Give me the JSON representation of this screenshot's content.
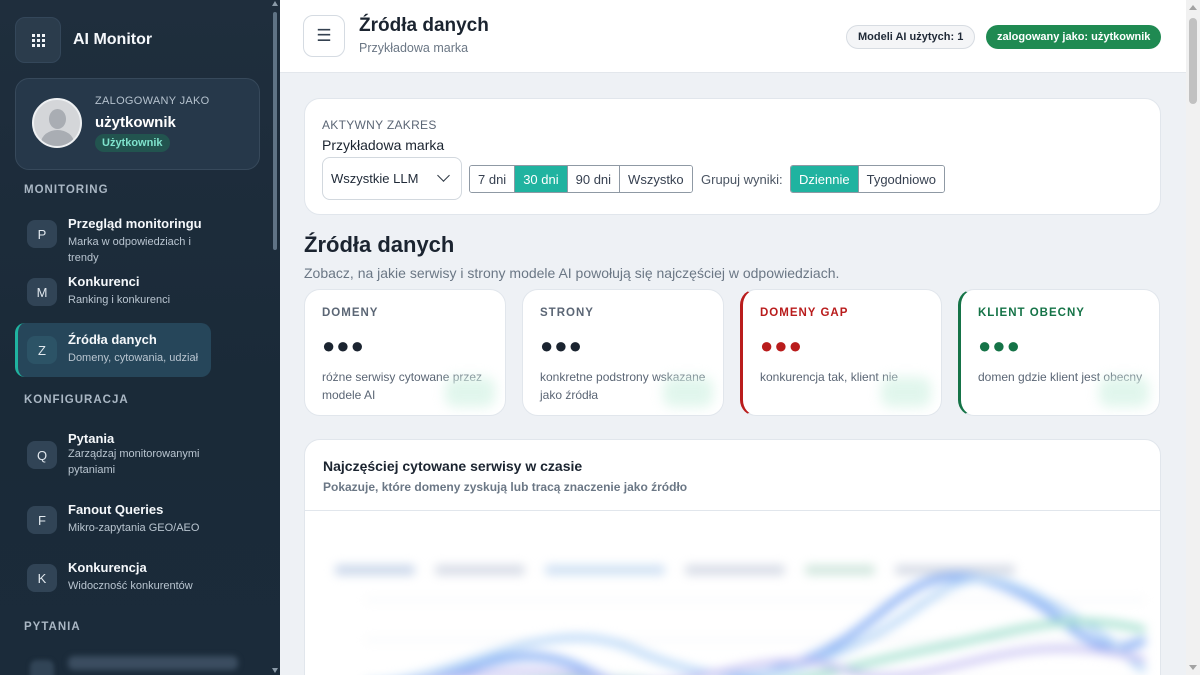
{
  "sidebar": {
    "app_name": "AI Monitor",
    "user": {
      "label": "ZALOGOWANY JAKO",
      "name": "użytkownik",
      "role": "Użytkownik"
    },
    "sections": {
      "monitoring": "MONITORING",
      "konfiguracja": "KONFIGURACJA",
      "pytania": "PYTANIA"
    },
    "items": [
      {
        "letter": "P",
        "title": "Przegląd monitoringu",
        "sub": "Marka w odpowiedziach i trendy"
      },
      {
        "letter": "M",
        "title": "Konkurenci",
        "sub": "Ranking i konkurenci"
      },
      {
        "letter": "Z",
        "title": "Źródła danych",
        "sub": "Domeny, cytowania, udział",
        "active": true
      },
      {
        "letter": "Q",
        "title": "Pytania",
        "sub": "Zarządzaj monitorowanymi pytaniami"
      },
      {
        "letter": "F",
        "title": "Fanout Queries",
        "sub": "Mikro-zapytania GEO/AEO"
      },
      {
        "letter": "K",
        "title": "Konkurencja",
        "sub": "Widoczność konkurentów"
      }
    ]
  },
  "header": {
    "menu_icon": "☰",
    "title": "Źródła danych",
    "subtitle": "Przykładowa marka",
    "models_pill": "Modeli AI użytych: 1",
    "logged_pill": "zalogowany jako: użytkownik"
  },
  "filter": {
    "label": "AKTYWNY ZAKRES",
    "brand": "Przykładowa marka",
    "llm_select": "Wszystkie LLM",
    "ranges": [
      "7 dni",
      "30 dni",
      "90 dni",
      "Wszystko"
    ],
    "active_range": "30 dni",
    "group_label": "Grupuj wyniki:",
    "groups": [
      "Dziennie",
      "Tygodniowo"
    ],
    "active_group": "Dziennie"
  },
  "section": {
    "title": "Źródła danych",
    "subtitle": "Zobacz, na jakie serwisy i strony modele AI powołują się najczęściej w odpowiedziach."
  },
  "stats": [
    {
      "label": "DOMENY",
      "value": "●●●",
      "desc": "różne serwisy cytowane przez modele AI"
    },
    {
      "label": "STRONY",
      "value": "●●●",
      "desc": "konkretne podstrony wskazane jako źródła"
    },
    {
      "label": "DOMENY GAP",
      "value": "●●●",
      "desc": "konkurencja tak, klient nie"
    },
    {
      "label": "KLIENT OBECNY",
      "value": "●●●",
      "desc": "domen gdzie klient jest obecny"
    }
  ],
  "chart": {
    "title": "Najczęściej cytowane serwisy w czasie",
    "subtitle": "Pokazuje, które domeny zyskują lub tracą znaczenie jako źródło",
    "colors": [
      "#8fb4f5",
      "#b9d7f7",
      "#a4e0cf",
      "#c7c1f2",
      "#f5c99a"
    ]
  }
}
